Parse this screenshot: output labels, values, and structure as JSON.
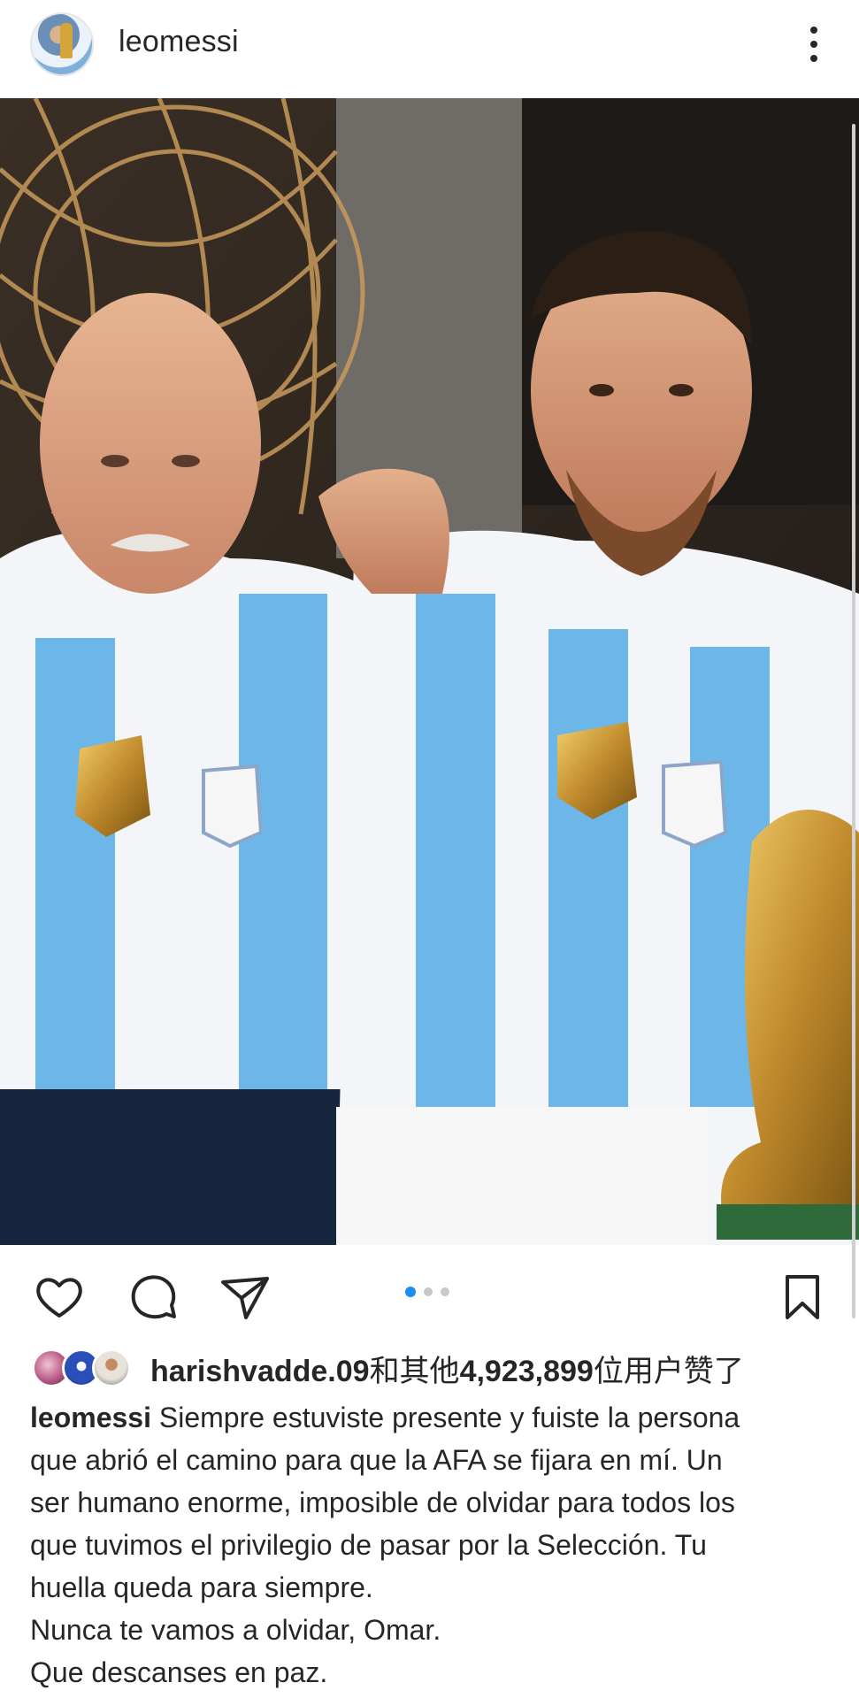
{
  "header": {
    "username": "leomessi",
    "avatar_icon": "profile-avatar",
    "more_icon": "more-vertical-icon"
  },
  "post": {
    "image_alt": "Photo of Messi and an older man in Argentina jerseys with the World Cup trophy",
    "carousel": {
      "total": 3,
      "active": 1
    }
  },
  "actions": {
    "like_icon": "heart-icon",
    "comment_icon": "comment-icon",
    "share_icon": "send-icon",
    "save_icon": "bookmark-icon"
  },
  "likes": {
    "first_user": "harishvadde.09",
    "connector": "和其他",
    "count": "4,923,899",
    "suffix": "位用户赞了"
  },
  "caption": {
    "username": "leomessi",
    "lines": [
      "Siempre estuviste presente y fuiste la persona",
      "que abrió el camino para que la AFA se fijara en mí. Un",
      "ser humano enorme, imposible de olvidar para todos los",
      "que tuvimos el privilegio de pasar por la Selección. Tu",
      "huella queda para siempre.",
      "Nunca te vamos a olvidar, Omar.",
      "Que descanses en paz."
    ]
  },
  "colors": {
    "text": "#262626",
    "carousel_active": "#1a8ef5",
    "carousel_inactive": "#c8c8c8",
    "jersey_blue": "#6cb6e8"
  }
}
